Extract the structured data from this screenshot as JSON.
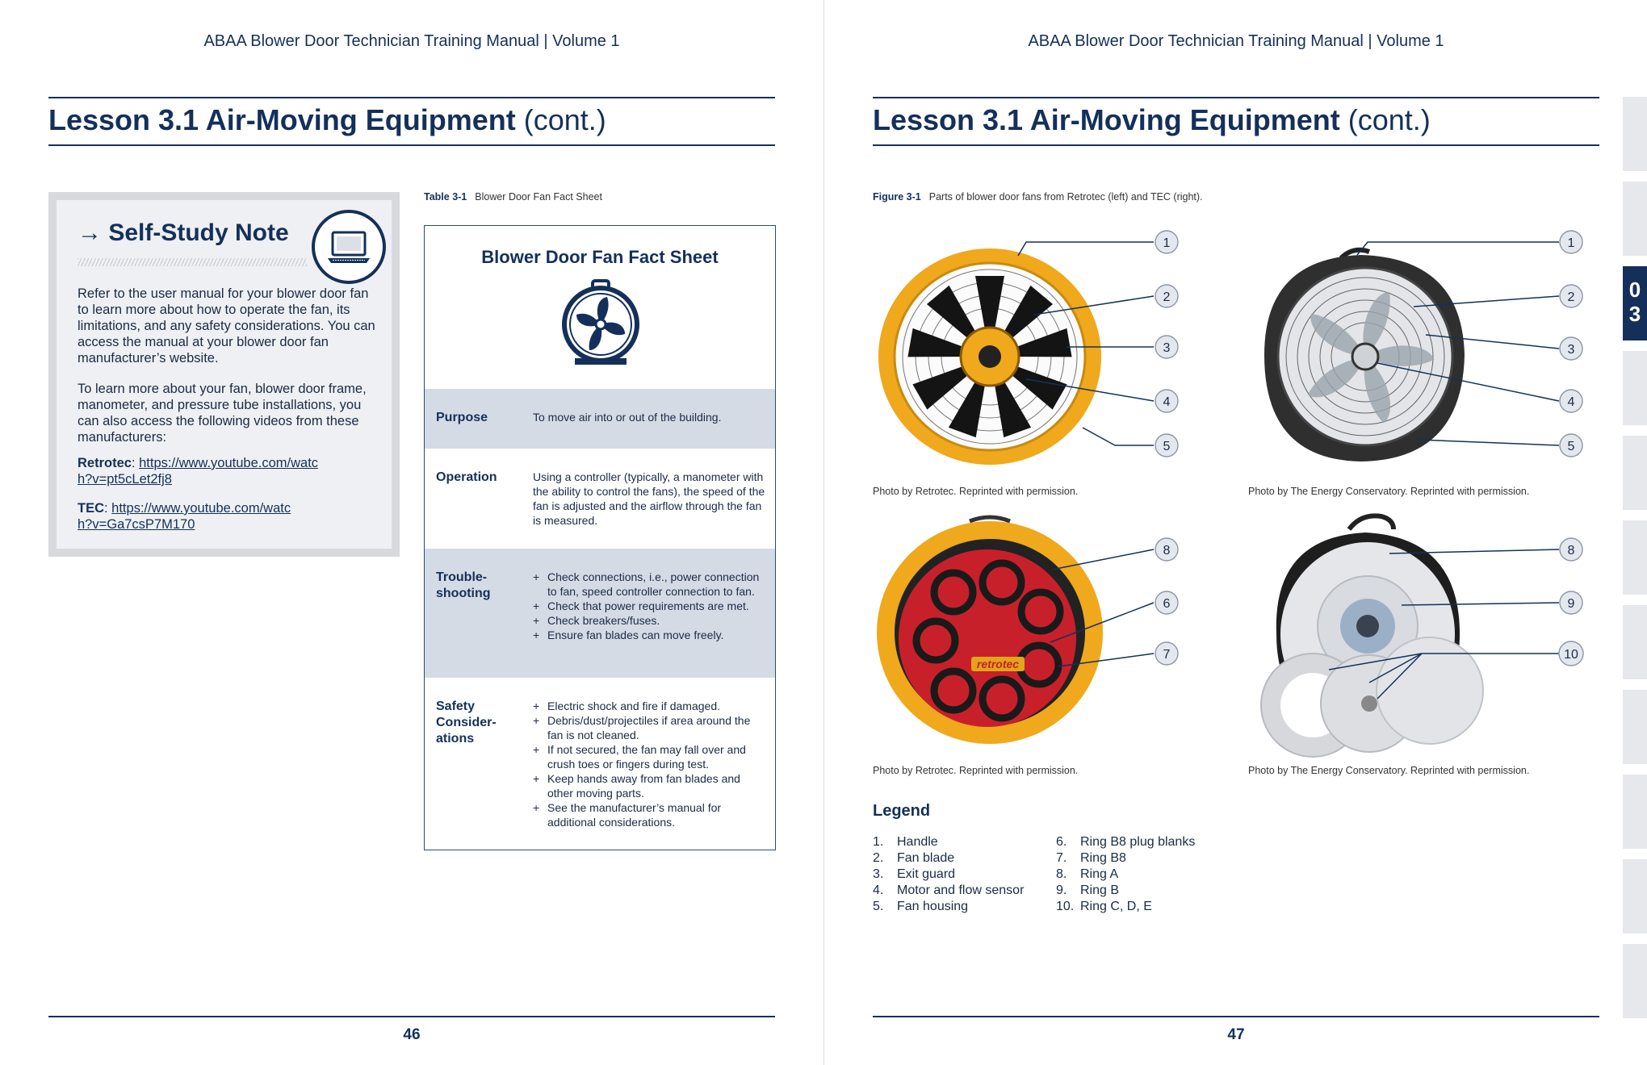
{
  "running_head": "ABAA Blower Door Technician Training Manual  |  Volume 1",
  "lesson_title_bold": "Lesson 3.1 Air-Moving Equipment",
  "lesson_title_suffix": " (cont.)",
  "left_page": {
    "page_number": "46",
    "self_study": {
      "heading": "→ Self-Study Note",
      "icon": "laptop-icon",
      "para1": "Refer to the user manual for your blower door fan to learn more about how to operate the fan, its limitations, and any safety considerations. You can access the manual at your blower door fan manufacturer’s website.",
      "para2": "To learn more about your fan, blower door frame, manometer, and pressure tube installa­tions, you can also access the following videos from these manufacturers:",
      "retrotec_label": "Retrotec",
      "retrotec_link": "https://www.youtube.com/watch?v=pt5cLet2fj8",
      "tec_label": "TEC",
      "tec_link": "https://www.youtube.com/watch?v=Ga7csP7M170"
    },
    "table": {
      "caption_num": "Table 3-1",
      "caption_text": "Blower Door Fan Fact Sheet",
      "title": "Blower Door Fan Fact Sheet",
      "icon": "fan-icon",
      "rows": [
        {
          "label": "Purpose",
          "text": "To move air into or out of the building."
        },
        {
          "label": "Operation",
          "text": "Using a controller (typically, a manometer with the ability to control the fans), the speed of the fan is adjusted and the airflow through the fan is measured."
        },
        {
          "label": "Trouble-shooting",
          "bullets": [
            "Check connections, i.e., power connection to fan, speed controller connection to fan.",
            "Check that power requirements are met.",
            "Check breakers/fuses.",
            "Ensure fan blades can move freely."
          ]
        },
        {
          "label": "Safety Consider-ations",
          "bullets": [
            "Electric shock and fire if damaged.",
            "Debris/dust/projectiles if area around the fan is not cleaned.",
            "If not secured, the fan may fall over and crush toes or fingers during test.",
            "Keep hands away from fan blades and other moving parts.",
            "See the manufacturer’s manual for additional considerations."
          ]
        }
      ]
    }
  },
  "right_page": {
    "page_number": "47",
    "figure": {
      "caption_num": "Figure 3-1",
      "caption_text": "Parts of blower door fans from Retrotec (left) and TEC (right).",
      "credit_retrotec": "Photo by Retrotec. Reprinted with permission.",
      "credit_tec": "Photo by The Energy Conservatory. Reprinted with permission.",
      "retrotec_brand": "retrotec",
      "callouts_top": [
        "1",
        "2",
        "3",
        "4",
        "5"
      ],
      "callouts_bottom_left": [
        "8",
        "6",
        "7"
      ],
      "callouts_bottom_right": [
        "8",
        "9",
        "10"
      ]
    },
    "legend": {
      "title": "Legend",
      "col1": [
        {
          "n": "1.",
          "t": "Handle"
        },
        {
          "n": "2.",
          "t": "Fan blade"
        },
        {
          "n": "3.",
          "t": "Exit guard"
        },
        {
          "n": "4.",
          "t": "Motor and flow sensor"
        },
        {
          "n": "5.",
          "t": "Fan housing"
        }
      ],
      "col2": [
        {
          "n": "6.",
          "t": "Ring B8 plug blanks"
        },
        {
          "n": "7.",
          "t": "Ring B8"
        },
        {
          "n": "8.",
          "t": "Ring A"
        },
        {
          "n": "9.",
          "t": "Ring B"
        },
        {
          "n": "10.",
          "t": "Ring C, D, E"
        }
      ]
    },
    "chapter_tab": "0 3"
  },
  "colors": {
    "navy": "#14305a",
    "shade": "#d5dbe5",
    "retrotec_yellow": "#f0a81c",
    "retrotec_red": "#c8202a"
  }
}
